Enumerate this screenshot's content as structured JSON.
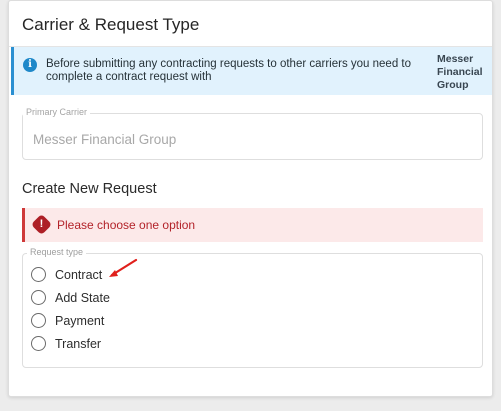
{
  "card": {
    "title": "Carrier & Request Type"
  },
  "info_alert": {
    "icon": "info-icon",
    "message": "Before submitting any contracting requests to other carriers you need to complete a contract request with",
    "carrier_name": "Messer Financial Group"
  },
  "primary_carrier": {
    "label": "Primary Carrier",
    "value": "Messer Financial Group"
  },
  "create_request": {
    "title": "Create New Request"
  },
  "error_alert": {
    "icon": "error-icon",
    "message": "Please choose one option"
  },
  "request_type": {
    "legend": "Request type",
    "options": [
      {
        "label": "Contract",
        "selected": false
      },
      {
        "label": "Add State",
        "selected": false
      },
      {
        "label": "Payment",
        "selected": false
      },
      {
        "label": "Transfer",
        "selected": false
      }
    ]
  },
  "colors": {
    "info_bg": "#e1f2fd",
    "info_accent": "#1e88c9",
    "error_bg": "#fce9e9",
    "error_accent": "#b3232a",
    "annotation_arrow": "#e0201c"
  }
}
